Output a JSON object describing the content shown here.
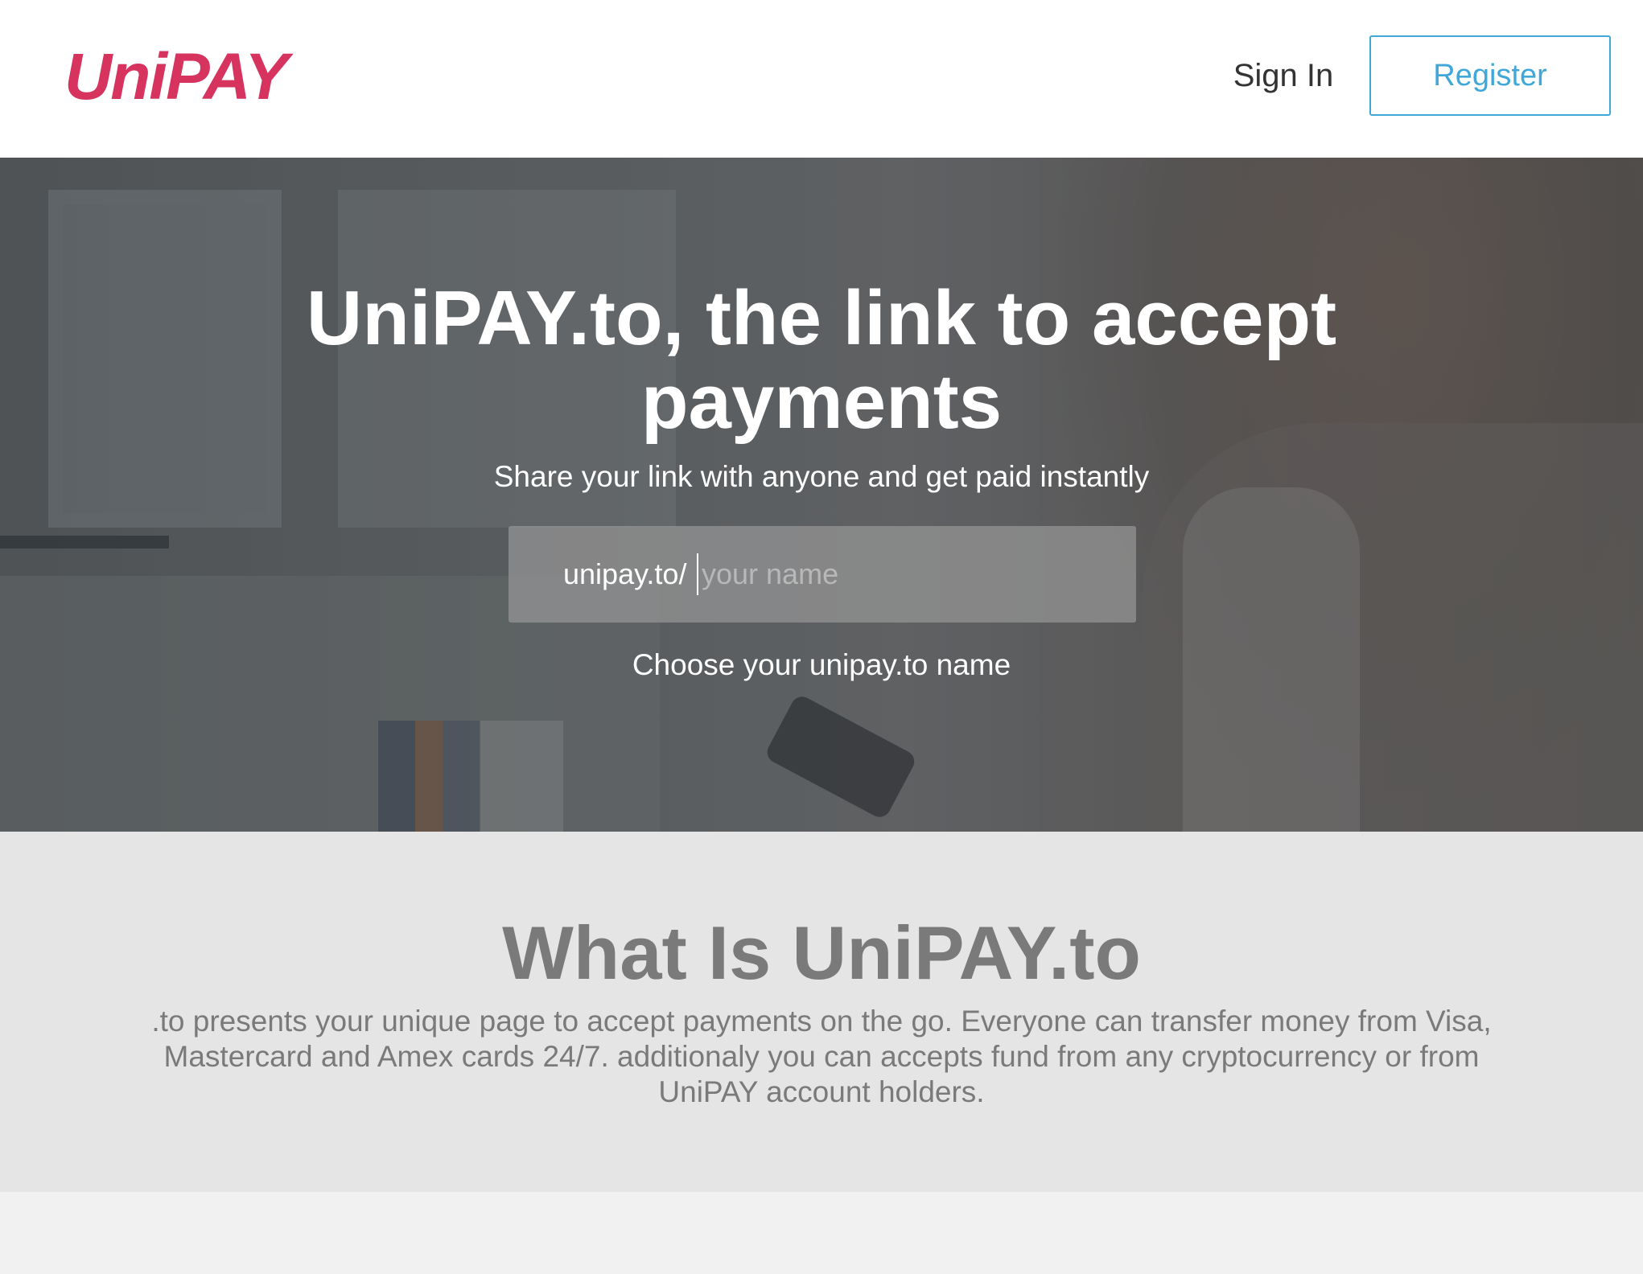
{
  "header": {
    "logo_text": "UniPAY",
    "sign_in_label": "Sign In",
    "register_label": "Register"
  },
  "hero": {
    "title": "UniPAY.to, the link to accept payments",
    "subtitle": "Share your link with anyone and get paid instantly",
    "link_prefix": "unipay.to/",
    "name_input": {
      "value": "",
      "placeholder": "your name"
    },
    "hint": "Choose your unipay.to name"
  },
  "about": {
    "title": "What Is UniPAY.to",
    "description": ".to presents your unique page to accept payments on the go. Everyone can transfer money from Visa, Mastercard and Amex cards 24/7. additionaly you can accepts fund from any cryptocurrency or from UniPAY account holders."
  },
  "colors": {
    "brand": "#d6345f",
    "accent": "#3fa8d8",
    "about_background": "#e5e5e5",
    "about_text": "#7a7a7a"
  }
}
